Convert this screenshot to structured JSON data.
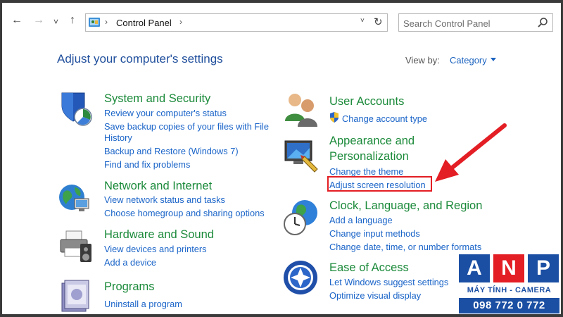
{
  "address_bar": {
    "back_icon": "←",
    "forward_icon": "→",
    "recent_icon": "˅",
    "up_icon": "↑",
    "path": "Control Panel",
    "separator": "›",
    "dropdown_icon": "˅",
    "refresh_icon": "↻",
    "search_placeholder": "Search Control Panel"
  },
  "header": {
    "title": "Adjust your computer's settings",
    "view_by_label": "View by:",
    "view_by_value": "Category"
  },
  "categories": {
    "system_security": {
      "title": "System and Security",
      "links": [
        "Review your computer's status",
        "Save backup copies of your files with File",
        "History",
        "Backup and Restore (Windows 7)",
        "Find and fix problems"
      ]
    },
    "network": {
      "title": "Network and Internet",
      "links": [
        "View network status and tasks",
        "Choose homegroup and sharing options"
      ]
    },
    "hardware": {
      "title": "Hardware and Sound",
      "links": [
        "View devices and printers",
        "Add a device"
      ]
    },
    "programs": {
      "title": "Programs",
      "links": [
        "Uninstall a program"
      ]
    },
    "user_accounts": {
      "title": "User Accounts",
      "links": [
        "Change account type"
      ]
    },
    "appearance": {
      "title_line1": "Appearance and",
      "title_line2": "Personalization",
      "links": [
        "Change the theme",
        "Adjust screen resolution"
      ]
    },
    "clock": {
      "title": "Clock, Language, and Region",
      "links": [
        "Add a language",
        "Change input methods",
        "Change date, time, or number formats"
      ]
    },
    "ease": {
      "title": "Ease of Access",
      "links": [
        "Let Windows suggest settings",
        "Optimize visual display"
      ]
    }
  },
  "brand": {
    "letters": [
      "A",
      "N",
      "P"
    ],
    "subtitle": "MÁY TÍNH - CAMERA",
    "phone": "098 772 0 772",
    "colors": {
      "blue": "#1b4fa3",
      "red": "#e31e24"
    }
  },
  "accent_colors": {
    "link": "#1a64c8",
    "category_title": "#1b8a3a",
    "highlight": "#e31e24"
  }
}
